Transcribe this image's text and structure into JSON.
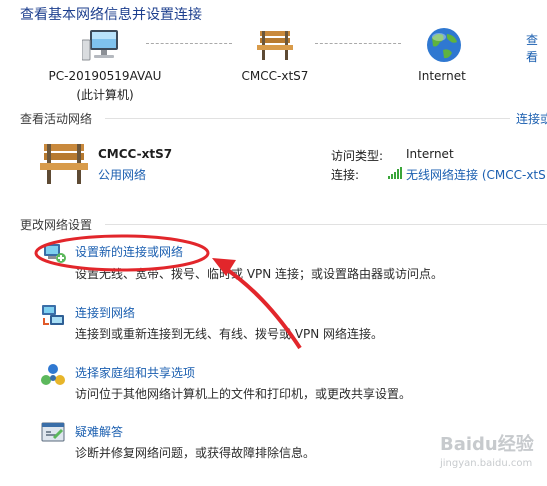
{
  "header": {
    "title": "查看基本网络信息并设置连接",
    "full_map_link": "查看"
  },
  "network_map": {
    "computer_name": "PC-20190519AVAU",
    "computer_sub": "(此计算机)",
    "network_name": "CMCC-xtS7",
    "internet_label": "Internet"
  },
  "active_network": {
    "section_title": "查看活动网络",
    "connect_link": "连接或",
    "name": "CMCC-xtS7",
    "type_link": "公用网络",
    "access_type_label": "访问类型:",
    "access_type_value": "Internet",
    "connections_label": "连接:",
    "connections_value": "无线网络连接 (CMCC-xtS"
  },
  "change_settings": {
    "section_title": "更改网络设置",
    "tasks": [
      {
        "title": "设置新的连接或网络",
        "desc": "设置无线、宽带、拨号、临时或 VPN 连接；或设置路由器或访问点。",
        "icon": "setup-connection-icon"
      },
      {
        "title": "连接到网络",
        "desc": "连接到或重新连接到无线、有线、拨号或 VPN 网络连接。",
        "icon": "connect-network-icon"
      },
      {
        "title": "选择家庭组和共享选项",
        "desc": "访问位于其他网络计算机上的文件和打印机，或更改共享设置。",
        "icon": "homegroup-icon"
      },
      {
        "title": "疑难解答",
        "desc": "诊断并修复网络问题，或获得故障排除信息。",
        "icon": "troubleshoot-icon"
      }
    ]
  },
  "annotation": {
    "color": "#e2262b"
  },
  "watermark": {
    "text": "Baidu经验",
    "sub": "jingyan.baidu.com"
  }
}
